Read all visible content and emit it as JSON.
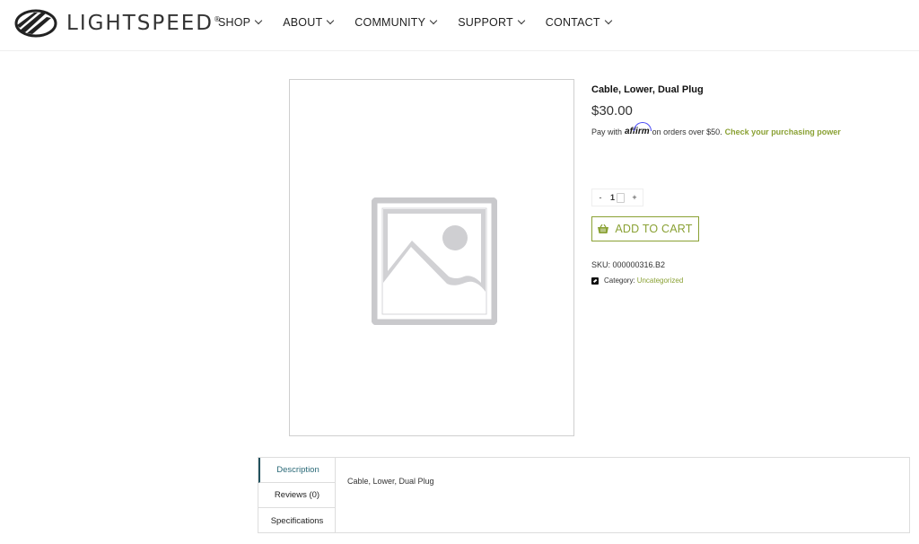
{
  "brand": {
    "name": "LIGHTSPEED",
    "reg": "®"
  },
  "nav": [
    {
      "label": "SHOP"
    },
    {
      "label": "ABOUT"
    },
    {
      "label": "COMMUNITY"
    },
    {
      "label": "SUPPORT"
    },
    {
      "label": "CONTACT"
    }
  ],
  "product": {
    "title": "Cable, Lower, Dual Plug",
    "price": "$30.00",
    "affirm": {
      "prefix": "Pay with",
      "logo": "affirm",
      "suffix": "on orders over $50.",
      "link": "Check your purchasing power"
    },
    "quantity": {
      "minus": "-",
      "value": "1",
      "plus": "+"
    },
    "add_to_cart": "ADD TO CART",
    "sku": "SKU: 000000316.B2",
    "category_label": "Category:",
    "category_value": "Uncategorized"
  },
  "tabs": [
    {
      "label": "Description",
      "active": true
    },
    {
      "label": "Reviews (0)",
      "active": false
    },
    {
      "label": "Specifications",
      "active": false
    }
  ],
  "tab_content": {
    "description": "Cable, Lower, Dual Plug"
  },
  "colors": {
    "accent": "#8aa134",
    "tab_active": "#2b6a78",
    "affirm_arc": "#4a4af4"
  },
  "icons": {
    "logo": "lightspeed-wing-logo",
    "chevron": "chevron-down-icon",
    "placeholder": "image-placeholder-icon",
    "basket": "basket-icon",
    "category": "folder-icon"
  }
}
